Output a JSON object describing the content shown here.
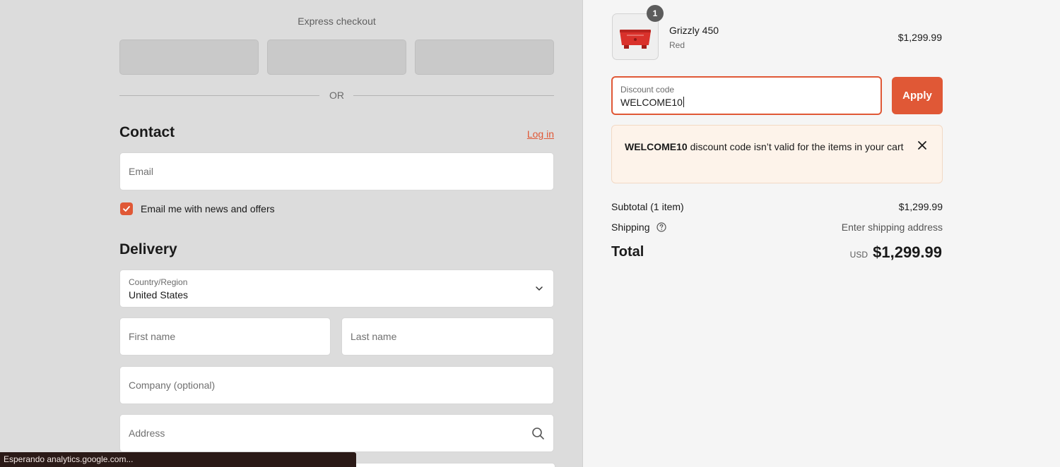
{
  "express": {
    "title": "Express checkout",
    "or_label": "OR"
  },
  "contact": {
    "heading": "Contact",
    "login_label": "Log in",
    "email_placeholder": "Email",
    "newsletter_checked": true,
    "newsletter_label": "Email me with news and offers"
  },
  "delivery": {
    "heading": "Delivery",
    "country_label": "Country/Region",
    "country_value": "United States",
    "first_name_placeholder": "First name",
    "last_name_placeholder": "Last name",
    "company_placeholder": "Company (optional)",
    "address_placeholder": "Address"
  },
  "status_bar": {
    "text": "Esperando analytics.google.com..."
  },
  "cart": {
    "item": {
      "quantity": "1",
      "name": "Grizzly 450",
      "variant": "Red",
      "price": "$1,299.99"
    },
    "discount": {
      "label": "Discount code",
      "value": "WELCOME10",
      "apply_label": "Apply"
    },
    "alert": {
      "code": "WELCOME10",
      "message": " discount code isn’t valid for the items in your cart"
    },
    "summary": {
      "subtotal_label": "Subtotal (1 item)",
      "subtotal_value": "$1,299.99",
      "shipping_label": "Shipping",
      "shipping_value": "Enter shipping address",
      "total_label": "Total",
      "currency": "USD",
      "total_value": "$1,299.99"
    }
  },
  "colors": {
    "accent": "#e05836",
    "alert_bg": "#fdf3ea",
    "left_bg": "#dcdcdc",
    "right_bg": "#f5f5f5"
  },
  "icons": [
    "checkmark-icon",
    "chevron-down-icon",
    "search-icon",
    "close-icon",
    "help-circle-icon",
    "product-image"
  ]
}
